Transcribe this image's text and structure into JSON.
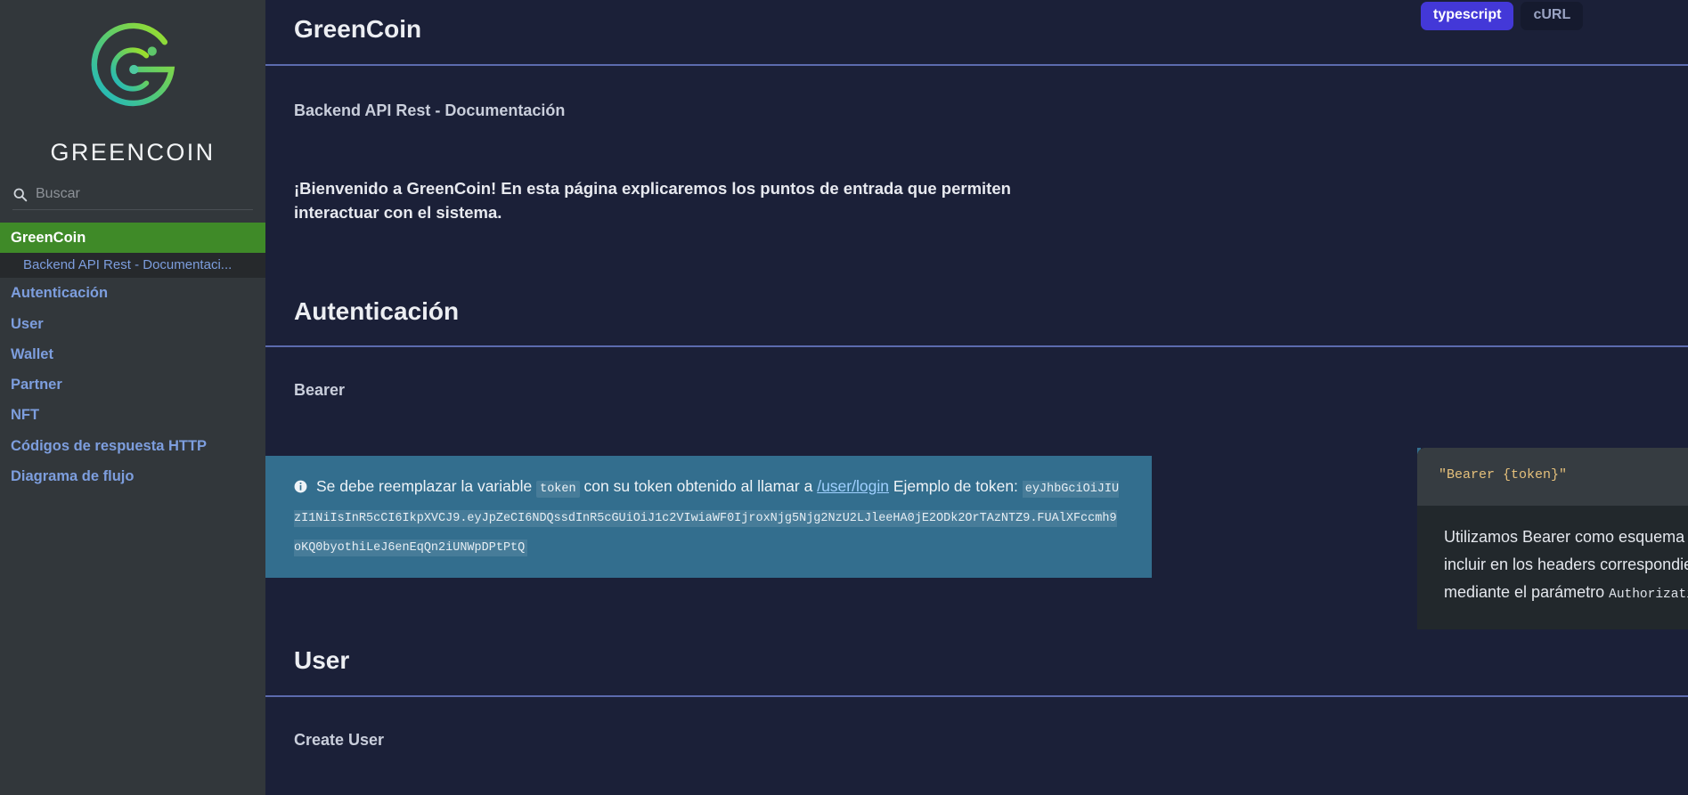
{
  "sidebar": {
    "brand": "GREENCOIN",
    "logo_icon": "greencoin-g-logo",
    "search": {
      "icon": "search-icon",
      "placeholder": "Buscar",
      "value": ""
    },
    "active_item": "GreenCoin",
    "items": [
      {
        "label": "GreenCoin",
        "active": true
      },
      {
        "label": "Backend API Rest - Documentaci...",
        "sub": true
      },
      {
        "label": "Autenticación"
      },
      {
        "label": "User"
      },
      {
        "label": "Wallet"
      },
      {
        "label": "Partner"
      },
      {
        "label": "NFT"
      },
      {
        "label": "Códigos de respuesta HTTP"
      },
      {
        "label": "Diagrama de flujo"
      }
    ]
  },
  "lang_tabs": {
    "items": [
      "typescript",
      "cURL"
    ],
    "active": "typescript",
    "typescript": "typescript",
    "curl": "cURL"
  },
  "main": {
    "title": "GreenCoin",
    "subtitle": "Backend API Rest - Documentación",
    "intro": "¡Bienvenido a GreenCoin! En esta página explicaremos los puntos de entrada que permiten interactuar con el sistema.",
    "auth_heading": "Autenticación",
    "bearer_heading": "Bearer",
    "callout": {
      "icon": "info-icon",
      "text_1": "Se debe reemplazar la variable",
      "chip": "token",
      "text_2": "con su token obtenido al llamar a",
      "link": "/user/login",
      "text_3": "Ejemplo de token:",
      "token": "eyJhbGciOiJIUzI1NiIsInR5cCI6IkpXVCJ9.eyJpZeCI6NDQssdInR5cGUiOiJ1c2VIwiaWF0IjroxNjg5Njg2NzU2LJleeHA0jE2ODk2OrTAzNTZ9.FUAlXFccmh9oKQ0byothiLeJ6enEqQn2iUNWpDPtPtQ"
    },
    "user_heading": "User",
    "create_user_heading": "Create User"
  },
  "code_panel": {
    "snippet": "\"Bearer {token}\"",
    "copy_icon": "copy-icon",
    "note_1": "Utilizamos Bearer como esquema de autenticación. Se deberá incluir en los headers correspondientes en cada llamada a la API mediante el parámetro",
    "note_mono": "Authorization"
  },
  "colors": {
    "sidebar_bg": "#32373b",
    "main_bg": "#1b2038",
    "active_nav": "#3f8a28",
    "nav_link": "#7d9ede",
    "rule": "#5c6bae",
    "callout_bg": "#336e8e",
    "tab_active": "#4338d8",
    "code_string": "#e5c07b"
  }
}
